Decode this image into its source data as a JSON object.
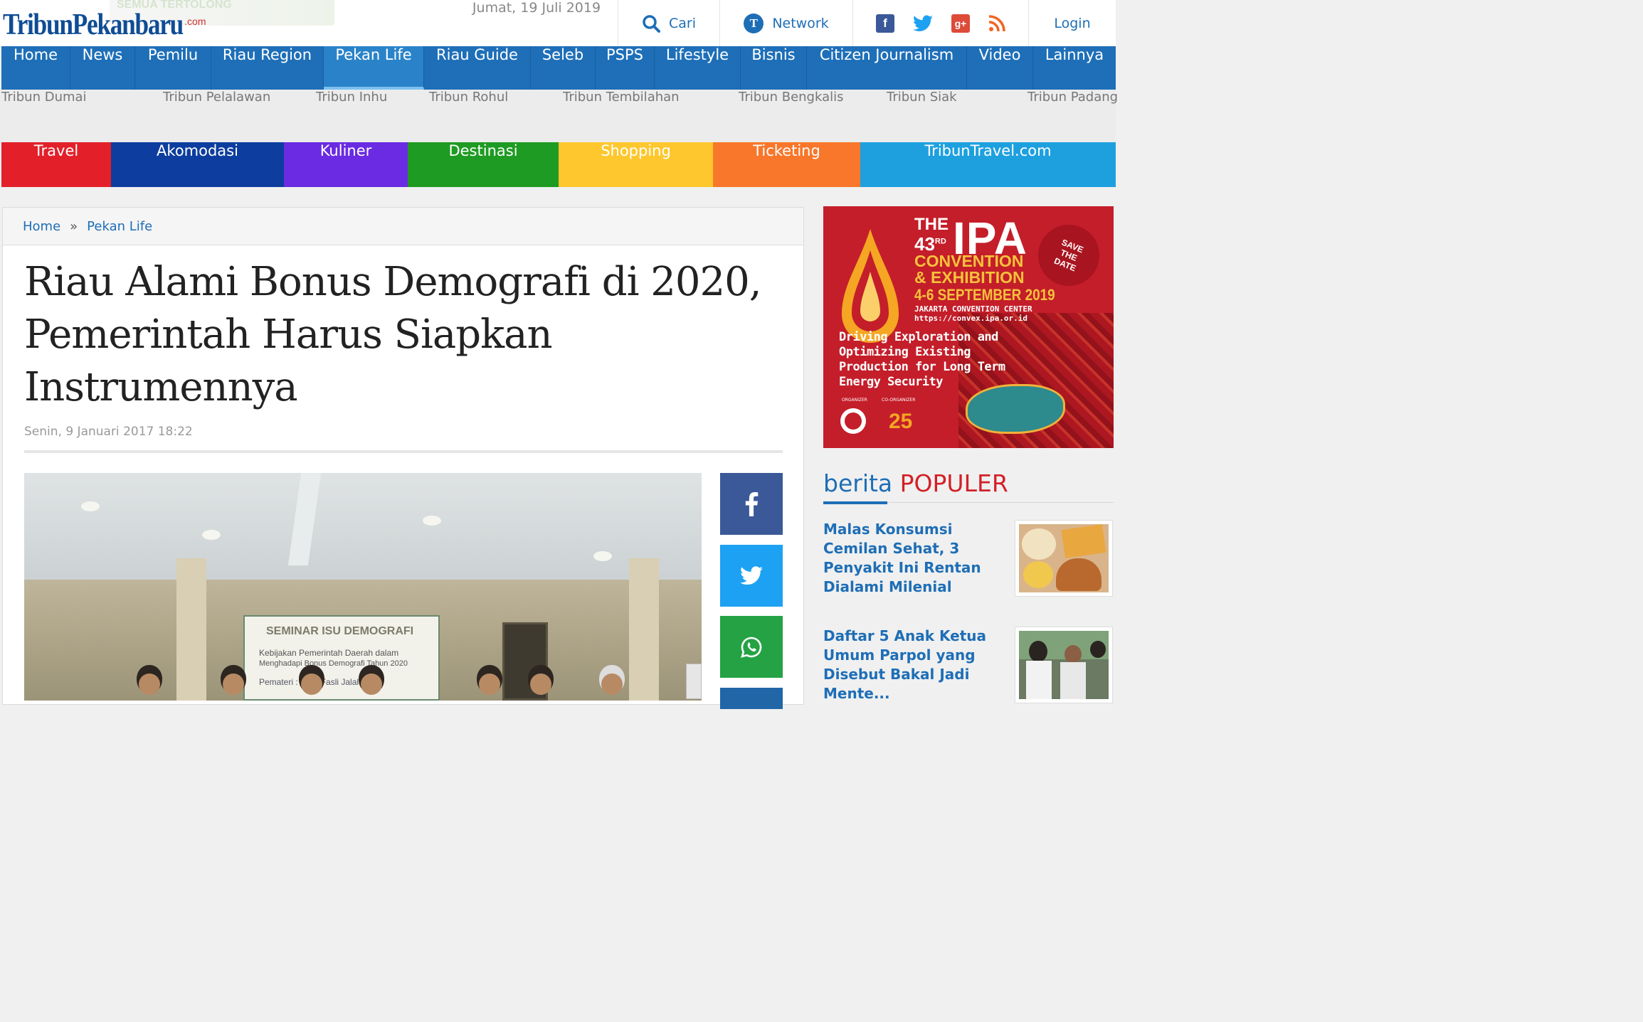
{
  "header": {
    "logo_text": "TribunPekanbaru",
    "logo_suffix": ".com",
    "logo_watermark": "SEMUA TERTOLONG",
    "date": "Jumat, 19 Juli 2019",
    "search_label": "Cari",
    "network_label": "Network",
    "login_label": "Login",
    "social_icons": [
      "facebook-icon",
      "twitter-icon",
      "google-plus-icon",
      "rss-icon"
    ]
  },
  "main_nav": {
    "active": "Pekan Life",
    "items": [
      "Home",
      "News",
      "Pemilu",
      "Riau Region",
      "Pekan Life",
      "Riau Guide",
      "Seleb",
      "PSPS",
      "Lifestyle",
      "Bisnis",
      "Citizen Journalism",
      "Video",
      "Lainnya"
    ]
  },
  "regional_nav": {
    "items": [
      "Tribun Dumai",
      "Tribun Pelalawan",
      "Tribun Inhu",
      "Tribun Rohul",
      "Tribun Tembilahan",
      "Tribun Bengkalis",
      "Tribun Siak",
      "Tribun Padang"
    ]
  },
  "travel_nav": {
    "items": [
      {
        "label": "Travel",
        "color": "#e3202a"
      },
      {
        "label": "Akomodasi",
        "color": "#0d3d9e"
      },
      {
        "label": "Kuliner",
        "color": "#6a2be2"
      },
      {
        "label": "Destinasi",
        "color": "#1e9b22"
      },
      {
        "label": "Shopping",
        "color": "#fdc72d"
      },
      {
        "label": "Ticketing",
        "color": "#f8772a"
      },
      {
        "label": "TribunTravel.com",
        "color": "#1ea0df"
      }
    ]
  },
  "breadcrumb": {
    "home": "Home",
    "separator": "»",
    "section": "Pekan Life"
  },
  "article": {
    "title": "Riau Alami Bonus Demografi di 2020, Pemerintah Harus Siapkan Instrumennya",
    "date": "Senin, 9 Januari 2017 18:22",
    "photo_banner": {
      "line1": "SEMINAR ISU DEMOGRAFI",
      "line2": "Kebijakan Pemerintah Daerah dalam",
      "line3": "Menghadapi Bonus Demografi Tahun 2020",
      "line4": "Pemateri : Prof. Fasli Jalal"
    },
    "share_buttons": [
      "facebook-icon",
      "twitter-icon",
      "whatsapp-icon"
    ]
  },
  "ad": {
    "the": "THE",
    "number": "43",
    "ordinal": "RD",
    "brand": "IPA",
    "event_line1": "CONVENTION",
    "event_line2": "& EXHIBITION",
    "dates": "4-6 SEPTEMBER 2019",
    "venue": "JAKARTA CONVENTION CENTER",
    "url": "https://convex.ipa.or.id",
    "tagline": [
      "Driving Exploration and",
      "Optimizing Existing",
      "Production for Long Term",
      "Energy Security"
    ],
    "badge": [
      "SAVE",
      "THE",
      "DATE"
    ],
    "organizer_label": "ORGANIZER",
    "co_organizer_label": "CO-ORGANIZER",
    "anniversary": "25"
  },
  "popular": {
    "heading_prefix": "berita",
    "heading_highlight": "POPULER",
    "items": [
      {
        "title": "Malas Konsumsi Cemilan Sehat, 3 Penyakit Ini Rentan Dialami Milenial"
      },
      {
        "title": "Daftar 5 Anak Ketua Umum Parpol yang Disebut Bakal Jadi Mente..."
      }
    ]
  },
  "colors": {
    "brand_blue": "#1e6fb8",
    "accent_red": "#d32027"
  }
}
